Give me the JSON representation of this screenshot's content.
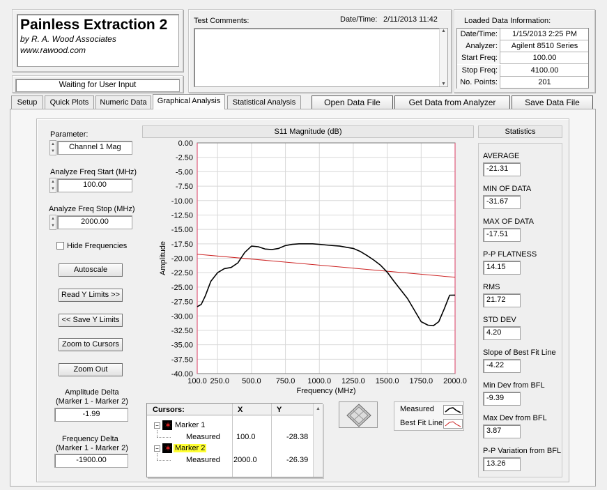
{
  "app": {
    "title": "Painless Extraction 2",
    "company": "by R. A. Wood Associates",
    "website": "www.rawood.com",
    "status": "Waiting for User Input"
  },
  "comments": {
    "label": "Test Comments:",
    "value": ""
  },
  "datetime": {
    "label": "Date/Time:",
    "value": "2/11/2013  11:42"
  },
  "loaded": {
    "title": "Loaded Data Information:",
    "rows": [
      {
        "label": "Date/Time:",
        "value": "1/15/2013 2:25 PM"
      },
      {
        "label": "Analyzer:",
        "value": "Agilent 8510 Series"
      },
      {
        "label": "Start Freq:",
        "value": "100.00"
      },
      {
        "label": "Stop Freq:",
        "value": "4100.00"
      },
      {
        "label": "No. Points:",
        "value": "201"
      }
    ]
  },
  "tabs": [
    "Setup",
    "Quick Plots",
    "Numeric Data",
    "Graphical Analysis",
    "Statistical Analysis"
  ],
  "actions": {
    "open": "Open Data File",
    "get": "Get Data from Analyzer",
    "save": "Save Data File"
  },
  "controls": {
    "parameter_label": "Parameter:",
    "parameter_value": "Channel 1 Mag",
    "freq_start_label": "Analyze Freq Start (MHz)",
    "freq_start_value": "100.00",
    "freq_stop_label": "Analyze Freq Stop (MHz)",
    "freq_stop_value": "2000.00",
    "hide_freq_label": "Hide Frequencies",
    "autoscale": "Autoscale",
    "read_y": "Read Y Limits >>",
    "save_y": "<< Save Y Limits",
    "zoom_cursors": "Zoom to Cursors",
    "zoom_out": "Zoom Out",
    "amp_delta_label1": "Amplitude Delta",
    "amp_delta_label2": "(Marker 1 - Marker 2)",
    "amp_delta_value": "-1.99",
    "freq_delta_label1": "Frequency Delta",
    "freq_delta_label2": "(Marker 1 - Marker 2)",
    "freq_delta_value": "-1900.00"
  },
  "cursors": {
    "header": "Cursors:",
    "col_x": "X",
    "col_y": "Y",
    "rows": [
      {
        "marker": "Marker 1",
        "sub": "Measured",
        "x": "100.0",
        "y": "-28.38"
      },
      {
        "marker": "Marker 2",
        "sub": "Measured",
        "x": "2000.0",
        "y": "-26.39"
      }
    ]
  },
  "legend": {
    "measured": "Measured",
    "bestfit": "Best Fit Line"
  },
  "colors": {
    "measured": "#000000",
    "bestfit": "#cc2222",
    "marker2_highlight": "#ffff33"
  },
  "statistics": {
    "title": "Statistics",
    "items": [
      {
        "label": "AVERAGE",
        "value": "-21.31"
      },
      {
        "label": "MIN OF DATA",
        "value": "-31.67"
      },
      {
        "label": "MAX OF DATA",
        "value": "-17.51"
      },
      {
        "label": "P-P FLATNESS",
        "value": "14.15"
      },
      {
        "label": "RMS",
        "value": "21.72"
      },
      {
        "label": "STD DEV",
        "value": "4.20"
      },
      {
        "label": "Slope of Best Fit Line",
        "value": "-4.22"
      },
      {
        "label": "Min Dev from BFL",
        "value": "-9.39"
      },
      {
        "label": "Max Dev from BFL",
        "value": "3.87"
      },
      {
        "label": "P-P Variation from BFL",
        "value": "13.26"
      }
    ]
  },
  "chart_data": {
    "type": "line",
    "title": "S11 Magnitude (dB)",
    "xlabel": "Frequency (MHz)",
    "ylabel": "Amplitude",
    "xlim": [
      100,
      2000
    ],
    "ylim": [
      -40,
      0
    ],
    "x_ticks": [
      "100.0",
      "250.0",
      "500.0",
      "750.0",
      "1000.0",
      "1250.0",
      "1500.0",
      "1750.0",
      "2000.0"
    ],
    "x_tick_values": [
      100,
      250,
      500,
      750,
      1000,
      1250,
      1500,
      1750,
      2000
    ],
    "y_ticks": [
      "0.00",
      "-2.50",
      "-5.00",
      "-7.50",
      "-10.00",
      "-12.50",
      "-15.00",
      "-17.50",
      "-20.00",
      "-22.50",
      "-25.00",
      "-27.50",
      "-30.00",
      "-32.50",
      "-35.00",
      "-37.50",
      "-40.00"
    ],
    "y_tick_values": [
      0,
      -2.5,
      -5,
      -7.5,
      -10,
      -12.5,
      -15,
      -17.5,
      -20,
      -22.5,
      -25,
      -27.5,
      -30,
      -32.5,
      -35,
      -37.5,
      -40
    ],
    "grid": true,
    "series": [
      {
        "name": "Measured",
        "x": [
          100,
          130,
          160,
          200,
          250,
          300,
          350,
          400,
          450,
          500,
          550,
          600,
          650,
          700,
          750,
          800,
          850,
          900,
          950,
          1000,
          1050,
          1100,
          1150,
          1200,
          1250,
          1300,
          1350,
          1400,
          1450,
          1500,
          1550,
          1600,
          1650,
          1700,
          1750,
          1800,
          1840,
          1880,
          1920,
          1960,
          2000
        ],
        "y": [
          -28.4,
          -28.0,
          -26.5,
          -24.0,
          -22.5,
          -21.8,
          -21.6,
          -20.8,
          -19.0,
          -17.9,
          -18.0,
          -18.4,
          -18.5,
          -18.3,
          -17.8,
          -17.6,
          -17.5,
          -17.5,
          -17.5,
          -17.6,
          -17.7,
          -17.8,
          -17.9,
          -18.1,
          -18.3,
          -18.8,
          -19.5,
          -20.3,
          -21.2,
          -22.4,
          -24.0,
          -25.5,
          -27.0,
          -29.0,
          -31.0,
          -31.6,
          -31.7,
          -31.0,
          -28.8,
          -26.4,
          -26.39
        ]
      },
      {
        "name": "Best Fit Line",
        "x": [
          100,
          2000
        ],
        "y": [
          -19.3,
          -23.3
        ]
      }
    ],
    "cursors": [
      {
        "name": "Marker 1",
        "x": 100
      },
      {
        "name": "Marker 2",
        "x": 2000
      }
    ]
  }
}
